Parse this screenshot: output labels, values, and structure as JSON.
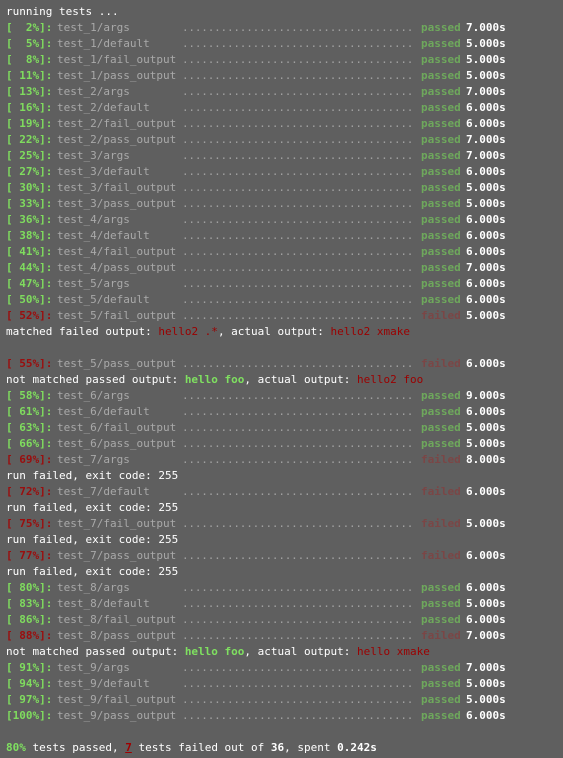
{
  "colors": {
    "background": "#5f5f5f",
    "pass": "#7fdc5e",
    "fail": "#9a0e0e",
    "status_pass": "#6ea85c",
    "status_fail": "#7b4646"
  },
  "dots": "....................................",
  "lines": [
    {
      "type": "msg",
      "parts": [
        {
          "text": "running tests ...",
          "style": "c-white"
        }
      ]
    },
    {
      "type": "test",
      "pct": "[  2%]:",
      "name": "test_1/args",
      "status": "passed",
      "time": "7.000s"
    },
    {
      "type": "test",
      "pct": "[  5%]:",
      "name": "test_1/default",
      "status": "passed",
      "time": "5.000s"
    },
    {
      "type": "test",
      "pct": "[  8%]:",
      "name": "test_1/fail_output",
      "status": "passed",
      "time": "5.000s"
    },
    {
      "type": "test",
      "pct": "[ 11%]:",
      "name": "test_1/pass_output",
      "status": "passed",
      "time": "5.000s"
    },
    {
      "type": "test",
      "pct": "[ 13%]:",
      "name": "test_2/args",
      "status": "passed",
      "time": "7.000s"
    },
    {
      "type": "test",
      "pct": "[ 16%]:",
      "name": "test_2/default",
      "status": "passed",
      "time": "6.000s"
    },
    {
      "type": "test",
      "pct": "[ 19%]:",
      "name": "test_2/fail_output",
      "status": "passed",
      "time": "6.000s"
    },
    {
      "type": "test",
      "pct": "[ 22%]:",
      "name": "test_2/pass_output",
      "status": "passed",
      "time": "7.000s"
    },
    {
      "type": "test",
      "pct": "[ 25%]:",
      "name": "test_3/args",
      "status": "passed",
      "time": "7.000s"
    },
    {
      "type": "test",
      "pct": "[ 27%]:",
      "name": "test_3/default",
      "status": "passed",
      "time": "6.000s"
    },
    {
      "type": "test",
      "pct": "[ 30%]:",
      "name": "test_3/fail_output",
      "status": "passed",
      "time": "5.000s"
    },
    {
      "type": "test",
      "pct": "[ 33%]:",
      "name": "test_3/pass_output",
      "status": "passed",
      "time": "5.000s"
    },
    {
      "type": "test",
      "pct": "[ 36%]:",
      "name": "test_4/args",
      "status": "passed",
      "time": "6.000s"
    },
    {
      "type": "test",
      "pct": "[ 38%]:",
      "name": "test_4/default",
      "status": "passed",
      "time": "6.000s"
    },
    {
      "type": "test",
      "pct": "[ 41%]:",
      "name": "test_4/fail_output",
      "status": "passed",
      "time": "6.000s"
    },
    {
      "type": "test",
      "pct": "[ 44%]:",
      "name": "test_4/pass_output",
      "status": "passed",
      "time": "7.000s"
    },
    {
      "type": "test",
      "pct": "[ 47%]:",
      "name": "test_5/args",
      "status": "passed",
      "time": "6.000s"
    },
    {
      "type": "test",
      "pct": "[ 50%]:",
      "name": "test_5/default",
      "status": "passed",
      "time": "6.000s"
    },
    {
      "type": "test",
      "pct": "[ 52%]:",
      "name": "test_5/fail_output",
      "status": "failed",
      "time": "5.000s"
    },
    {
      "type": "msg",
      "parts": [
        {
          "text": "matched failed output: ",
          "style": "c-white"
        },
        {
          "text": "hello2 .*",
          "style": "c-red"
        },
        {
          "text": ", actual output: ",
          "style": "c-white"
        },
        {
          "text": "hello2 xmake",
          "style": "c-red"
        }
      ]
    },
    {
      "type": "blank"
    },
    {
      "type": "test",
      "pct": "[ 55%]:",
      "name": "test_5/pass_output",
      "status": "failed",
      "time": "6.000s"
    },
    {
      "type": "msg",
      "parts": [
        {
          "text": "not matched passed output: ",
          "style": "c-white"
        },
        {
          "text": "hello foo",
          "style": "c-green"
        },
        {
          "text": ", actual output: ",
          "style": "c-white"
        },
        {
          "text": "hello2 foo",
          "style": "c-red"
        }
      ]
    },
    {
      "type": "test",
      "pct": "[ 58%]:",
      "name": "test_6/args",
      "status": "passed",
      "time": "9.000s"
    },
    {
      "type": "test",
      "pct": "[ 61%]:",
      "name": "test_6/default",
      "status": "passed",
      "time": "6.000s"
    },
    {
      "type": "test",
      "pct": "[ 63%]:",
      "name": "test_6/fail_output",
      "status": "passed",
      "time": "5.000s"
    },
    {
      "type": "test",
      "pct": "[ 66%]:",
      "name": "test_6/pass_output",
      "status": "passed",
      "time": "5.000s"
    },
    {
      "type": "test",
      "pct": "[ 69%]:",
      "name": "test_7/args",
      "status": "failed",
      "time": "8.000s"
    },
    {
      "type": "msg",
      "parts": [
        {
          "text": "run failed, exit code: 255",
          "style": "c-white"
        }
      ]
    },
    {
      "type": "test",
      "pct": "[ 72%]:",
      "name": "test_7/default",
      "status": "failed",
      "time": "6.000s"
    },
    {
      "type": "msg",
      "parts": [
        {
          "text": "run failed, exit code: 255",
          "style": "c-white"
        }
      ]
    },
    {
      "type": "test",
      "pct": "[ 75%]:",
      "name": "test_7/fail_output",
      "status": "failed",
      "time": "5.000s"
    },
    {
      "type": "msg",
      "parts": [
        {
          "text": "run failed, exit code: 255",
          "style": "c-white"
        }
      ]
    },
    {
      "type": "test",
      "pct": "[ 77%]:",
      "name": "test_7/pass_output",
      "status": "failed",
      "time": "6.000s"
    },
    {
      "type": "msg",
      "parts": [
        {
          "text": "run failed, exit code: 255",
          "style": "c-white"
        }
      ]
    },
    {
      "type": "test",
      "pct": "[ 80%]:",
      "name": "test_8/args",
      "status": "passed",
      "time": "6.000s"
    },
    {
      "type": "test",
      "pct": "[ 83%]:",
      "name": "test_8/default",
      "status": "passed",
      "time": "5.000s"
    },
    {
      "type": "test",
      "pct": "[ 86%]:",
      "name": "test_8/fail_output",
      "status": "passed",
      "time": "6.000s"
    },
    {
      "type": "test",
      "pct": "[ 88%]:",
      "name": "test_8/pass_output",
      "status": "failed",
      "time": "7.000s"
    },
    {
      "type": "msg",
      "parts": [
        {
          "text": "not matched passed output: ",
          "style": "c-white"
        },
        {
          "text": "hello foo",
          "style": "c-green"
        },
        {
          "text": ", actual output: ",
          "style": "c-white"
        },
        {
          "text": "hello xmake",
          "style": "c-red"
        }
      ]
    },
    {
      "type": "test",
      "pct": "[ 91%]:",
      "name": "test_9/args",
      "status": "passed",
      "time": "7.000s"
    },
    {
      "type": "test",
      "pct": "[ 94%]:",
      "name": "test_9/default",
      "status": "passed",
      "time": "5.000s"
    },
    {
      "type": "test",
      "pct": "[ 97%]:",
      "name": "test_9/fail_output",
      "status": "passed",
      "time": "5.000s"
    },
    {
      "type": "test",
      "pct": "[100%]:",
      "name": "test_9/pass_output",
      "status": "passed",
      "time": "6.000s"
    },
    {
      "type": "blank"
    },
    {
      "type": "msg",
      "parts": [
        {
          "text": "80%",
          "style": "c-green"
        },
        {
          "text": " tests passed, ",
          "style": "c-white"
        },
        {
          "text": "7",
          "style": "c-redb u"
        },
        {
          "text": " tests failed out of ",
          "style": "c-white"
        },
        {
          "text": "36",
          "style": "c-bwhite"
        },
        {
          "text": ", spent ",
          "style": "c-white"
        },
        {
          "text": "0.242s",
          "style": "c-bwhite"
        }
      ]
    }
  ]
}
